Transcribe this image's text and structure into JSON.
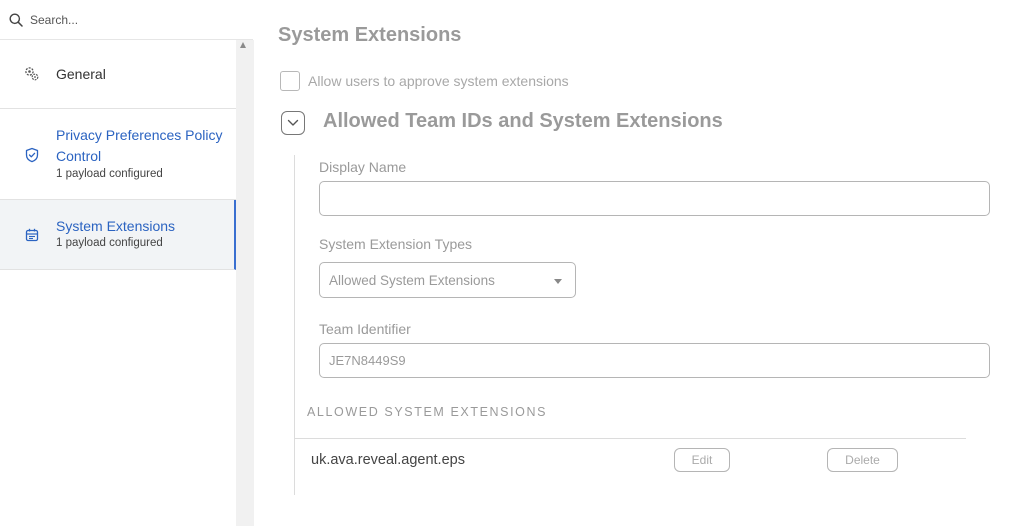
{
  "search": {
    "placeholder": "Search..."
  },
  "sidebar": {
    "items": [
      {
        "label": "General",
        "icon": "gears-icon"
      },
      {
        "label": "Privacy Preferences Policy Control",
        "sub": "1 payload configured",
        "icon": "shield-check-icon"
      },
      {
        "label": "System Extensions",
        "sub": "1 payload configured",
        "icon": "extension-icon",
        "selected": true
      }
    ]
  },
  "main": {
    "title": "System Extensions",
    "allow_users_label": "Allow users to approve system extensions",
    "allow_users_checked": false,
    "section_title": "Allowed Team IDs and System Extensions",
    "display_name": {
      "label": "Display Name",
      "value": ""
    },
    "extension_types": {
      "label": "System Extension Types",
      "value": "Allowed System Extensions"
    },
    "team_identifier": {
      "label": "Team Identifier",
      "value": "JE7N8449S9"
    },
    "list": {
      "heading": "ALLOWED SYSTEM EXTENSIONS",
      "items": [
        {
          "name": "uk.ava.reveal.agent.eps",
          "edit_label": "Edit",
          "delete_label": "Delete"
        }
      ]
    }
  },
  "colors": {
    "accent": "#2b63c1",
    "muted_text": "#9a9a9a",
    "selected_bg": "#f2f4f6"
  }
}
